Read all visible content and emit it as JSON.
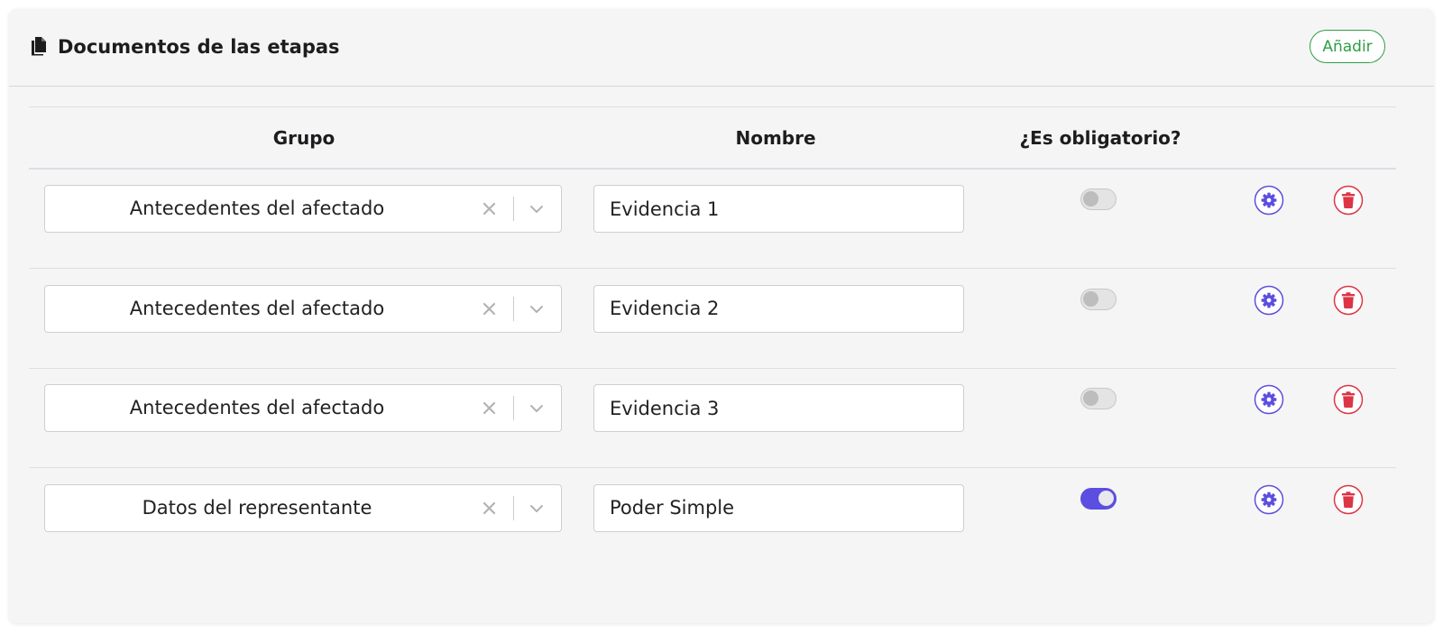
{
  "panel": {
    "title": "Documentos de las etapas",
    "header_icon": "documents-icon",
    "add_label": "Añadir"
  },
  "table": {
    "columns": [
      "Grupo",
      "Nombre",
      "¿Es obligatorio?"
    ],
    "rows": [
      {
        "group": "Antecedentes del afectado",
        "name": "Evidencia 1",
        "required": false
      },
      {
        "group": "Antecedentes del afectado",
        "name": "Evidencia 2",
        "required": false
      },
      {
        "group": "Antecedentes del afectado",
        "name": "Evidencia 3",
        "required": false
      },
      {
        "group": "Datos del representante",
        "name": "Poder Simple",
        "required": true
      }
    ]
  },
  "icons": {
    "clear": "clear-icon",
    "dropdown": "chevron-down-icon",
    "settings": "gear-icon",
    "delete": "trash-icon"
  },
  "colors": {
    "add_green": "#2e9e44",
    "accent_purple": "#5b4ee0",
    "delete_red": "#dc3545",
    "panel_bg": "#f5f5f5"
  }
}
